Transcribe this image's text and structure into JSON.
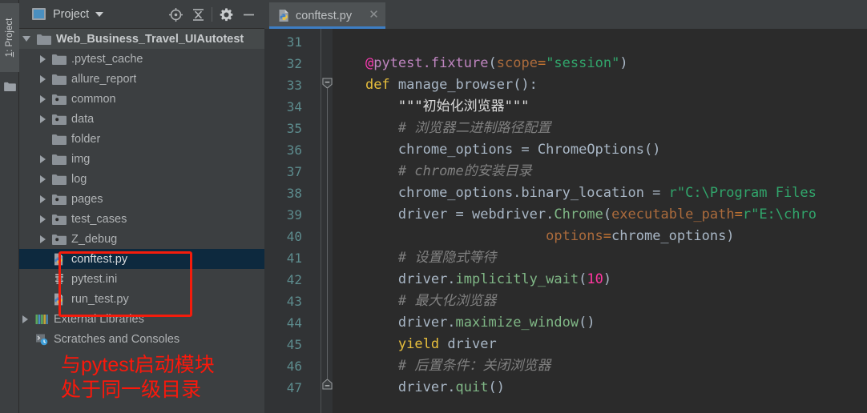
{
  "toolstrip": {
    "tab_label_prefix": "1",
    "tab_label_rest": ": Project",
    "folder_icon": "folder-icon"
  },
  "project_panel": {
    "title": "Project",
    "header_icons": [
      {
        "name": "locate-target-icon",
        "label": "Select Opened File"
      },
      {
        "name": "collapse-all-icon",
        "label": "Collapse All"
      },
      {
        "name": "gear-icon",
        "label": "Settings"
      },
      {
        "name": "minimize-icon",
        "label": "Hide"
      }
    ],
    "tree": [
      {
        "label": "Web_Business_Travel_UIAutotest",
        "icon": "folder-icon",
        "arrow": "open",
        "depth": 0,
        "state": "root"
      },
      {
        "label": ".pytest_cache",
        "icon": "folder-icon",
        "arrow": "closed",
        "depth": 1,
        "state": "normal"
      },
      {
        "label": "allure_report",
        "icon": "folder-icon",
        "arrow": "closed",
        "depth": 1,
        "state": "normal"
      },
      {
        "label": "common",
        "icon": "folder-package-icon",
        "arrow": "closed",
        "depth": 1,
        "state": "normal"
      },
      {
        "label": "data",
        "icon": "folder-package-icon",
        "arrow": "closed",
        "depth": 1,
        "state": "normal"
      },
      {
        "label": "folder",
        "icon": "folder-icon",
        "arrow": "none",
        "depth": 1,
        "state": "normal"
      },
      {
        "label": "img",
        "icon": "folder-icon",
        "arrow": "closed",
        "depth": 1,
        "state": "normal"
      },
      {
        "label": "log",
        "icon": "folder-icon",
        "arrow": "closed",
        "depth": 1,
        "state": "normal"
      },
      {
        "label": "pages",
        "icon": "folder-package-icon",
        "arrow": "closed",
        "depth": 1,
        "state": "normal"
      },
      {
        "label": "test_cases",
        "icon": "folder-package-icon",
        "arrow": "closed",
        "depth": 1,
        "state": "normal"
      },
      {
        "label": "Z_debug",
        "icon": "folder-package-icon",
        "arrow": "closed",
        "depth": 1,
        "state": "normal"
      },
      {
        "label": "conftest.py",
        "icon": "python-file-icon",
        "arrow": "none",
        "depth": 1,
        "state": "selected"
      },
      {
        "label": "pytest.ini",
        "icon": "ini-file-icon",
        "arrow": "none",
        "depth": 1,
        "state": "normal"
      },
      {
        "label": "run_test.py",
        "icon": "python-file-icon",
        "arrow": "none",
        "depth": 1,
        "state": "normal"
      },
      {
        "label": "External Libraries",
        "icon": "libraries-icon",
        "arrow": "closed",
        "depth": 0,
        "state": "normal"
      },
      {
        "label": "Scratches and Consoles",
        "icon": "scratches-icon",
        "arrow": "none",
        "depth": 0,
        "state": "normal"
      }
    ],
    "annotation": {
      "box_name": "red-highlight-box",
      "line1": "与pytest启动模块",
      "line2": "处于同一级目录",
      "color": "#fb180b"
    }
  },
  "editor": {
    "tab": {
      "name": "conftest.py",
      "icon": "python-file-icon",
      "close": "✕"
    },
    "first_line_number": 31,
    "line_numbers": [
      31,
      32,
      33,
      34,
      35,
      36,
      37,
      38,
      39,
      40,
      41,
      42,
      43,
      44,
      45,
      46,
      47
    ],
    "code": [
      {
        "n": 31,
        "tokens": []
      },
      {
        "n": 32,
        "tokens": [
          {
            "t": "    ",
            "c": "t-plain"
          },
          {
            "t": "@",
            "c": "t-decoat"
          },
          {
            "t": "pytest.fixture",
            "c": "t-deconame"
          },
          {
            "t": "(",
            "c": "t-plain"
          },
          {
            "t": "scope",
            "c": "t-param"
          },
          {
            "t": "=",
            "c": "t-kw"
          },
          {
            "t": "\"session\"",
            "c": "t-str"
          },
          {
            "t": ")",
            "c": "t-plain"
          }
        ]
      },
      {
        "n": 33,
        "tokens": [
          {
            "t": "    ",
            "c": "t-plain"
          },
          {
            "t": "def",
            "c": "t-kw2"
          },
          {
            "t": " manage_browser():",
            "c": "t-plain"
          }
        ]
      },
      {
        "n": 34,
        "tokens": [
          {
            "t": "        ",
            "c": "t-plain"
          },
          {
            "t": "\"\"\"初始化浏览器\"\"\"",
            "c": "t-doc"
          }
        ]
      },
      {
        "n": 35,
        "tokens": [
          {
            "t": "        ",
            "c": "t-plain"
          },
          {
            "t": "# 浏览器二进制路径配置",
            "c": "t-comment"
          }
        ]
      },
      {
        "n": 36,
        "tokens": [
          {
            "t": "        ",
            "c": "t-plain"
          },
          {
            "t": "chrome_options ",
            "c": "t-plain"
          },
          {
            "t": "=",
            "c": "t-op"
          },
          {
            "t": " ChromeOptions()",
            "c": "t-plain"
          }
        ]
      },
      {
        "n": 37,
        "tokens": [
          {
            "t": "        ",
            "c": "t-plain"
          },
          {
            "t": "# chrome的安装目录",
            "c": "t-comment"
          }
        ]
      },
      {
        "n": 38,
        "tokens": [
          {
            "t": "        ",
            "c": "t-plain"
          },
          {
            "t": "chrome_options.binary_location ",
            "c": "t-plain"
          },
          {
            "t": "=",
            "c": "t-op"
          },
          {
            "t": " r\"C:\\Program Files",
            "c": "t-str"
          }
        ]
      },
      {
        "n": 39,
        "tokens": [
          {
            "t": "        ",
            "c": "t-plain"
          },
          {
            "t": "driver ",
            "c": "t-plain"
          },
          {
            "t": "=",
            "c": "t-op"
          },
          {
            "t": " webdriver.",
            "c": "t-plain"
          },
          {
            "t": "Chrome",
            "c": "t-func"
          },
          {
            "t": "(",
            "c": "t-plain"
          },
          {
            "t": "executable_path",
            "c": "t-param"
          },
          {
            "t": "=",
            "c": "t-kw"
          },
          {
            "t": "r\"E:\\chro",
            "c": "t-str"
          }
        ]
      },
      {
        "n": 40,
        "tokens": [
          {
            "t": "                          ",
            "c": "t-plain"
          },
          {
            "t": "options",
            "c": "t-param"
          },
          {
            "t": "=",
            "c": "t-kw"
          },
          {
            "t": "chrome_options)",
            "c": "t-plain"
          }
        ]
      },
      {
        "n": 41,
        "tokens": [
          {
            "t": "        ",
            "c": "t-plain"
          },
          {
            "t": "# 设置隐式等待",
            "c": "t-comment"
          }
        ]
      },
      {
        "n": 42,
        "tokens": [
          {
            "t": "        ",
            "c": "t-plain"
          },
          {
            "t": "driver.",
            "c": "t-plain"
          },
          {
            "t": "implicitly_wait",
            "c": "t-func"
          },
          {
            "t": "(",
            "c": "t-plain"
          },
          {
            "t": "10",
            "c": "t-num"
          },
          {
            "t": ")",
            "c": "t-plain"
          }
        ]
      },
      {
        "n": 43,
        "tokens": [
          {
            "t": "        ",
            "c": "t-plain"
          },
          {
            "t": "# 最大化浏览器",
            "c": "t-comment"
          }
        ]
      },
      {
        "n": 44,
        "tokens": [
          {
            "t": "        ",
            "c": "t-plain"
          },
          {
            "t": "driver.",
            "c": "t-plain"
          },
          {
            "t": "maximize_window",
            "c": "t-func"
          },
          {
            "t": "()",
            "c": "t-plain"
          }
        ]
      },
      {
        "n": 45,
        "tokens": [
          {
            "t": "        ",
            "c": "t-plain"
          },
          {
            "t": "yield",
            "c": "t-kw2"
          },
          {
            "t": " driver",
            "c": "t-plain"
          }
        ]
      },
      {
        "n": 46,
        "tokens": [
          {
            "t": "        ",
            "c": "t-plain"
          },
          {
            "t": "# 后置条件：关闭浏览器",
            "c": "t-comment"
          }
        ]
      },
      {
        "n": 47,
        "tokens": [
          {
            "t": "        ",
            "c": "t-plain"
          },
          {
            "t": "driver.",
            "c": "t-plain"
          },
          {
            "t": "quit",
            "c": "t-func"
          },
          {
            "t": "()",
            "c": "t-plain"
          }
        ]
      }
    ]
  },
  "colors": {
    "panel_bg": "#3c3f41",
    "editor_bg": "#2b2b2b",
    "gutter_bg": "#313335",
    "selection_bg": "#0d293e",
    "tab_accent": "#3d7ec4",
    "annotation_red": "#fb180b"
  }
}
